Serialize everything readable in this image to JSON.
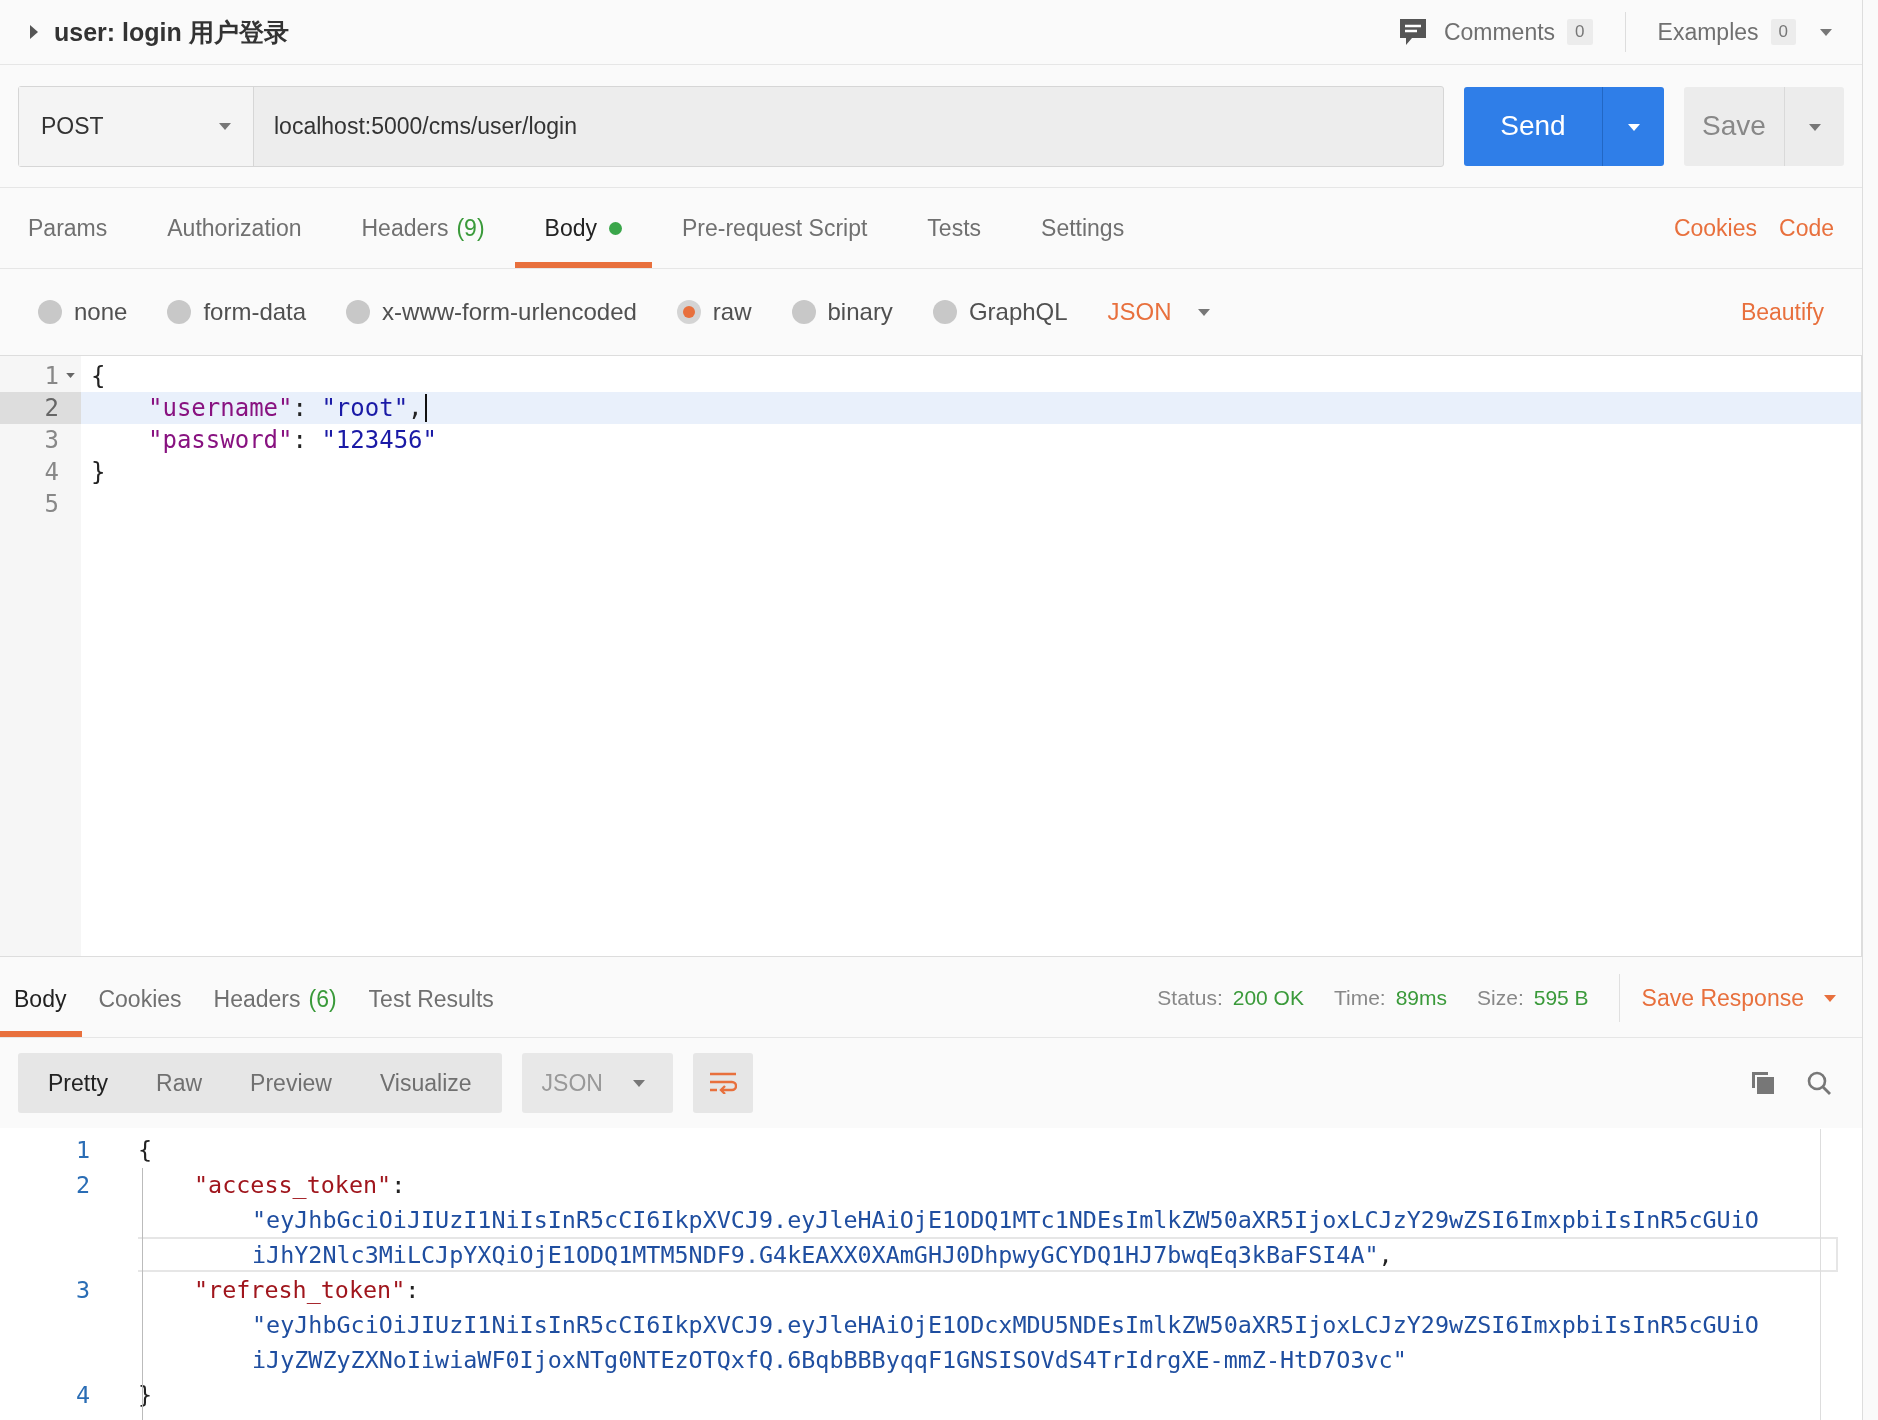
{
  "request": {
    "title": "user: login 用户登录",
    "comments": {
      "label": "Comments",
      "count": "0"
    },
    "examples": {
      "label": "Examples",
      "count": "0"
    },
    "method": "POST",
    "url": "localhost:5000/cms/user/login",
    "send": "Send",
    "save": "Save",
    "tabs": [
      {
        "label": "Params",
        "selected": false
      },
      {
        "label": "Authorization",
        "selected": false
      },
      {
        "label": "Headers",
        "count": "(9)",
        "selected": false
      },
      {
        "label": "Body",
        "dot": true,
        "selected": true
      },
      {
        "label": "Pre-request Script",
        "selected": false
      },
      {
        "label": "Tests",
        "selected": false
      },
      {
        "label": "Settings",
        "selected": false
      }
    ],
    "links": [
      "Cookies",
      "Code"
    ],
    "body_types": [
      {
        "label": "none",
        "selected": false
      },
      {
        "label": "form-data",
        "selected": false
      },
      {
        "label": "x-www-form-urlencoded",
        "selected": false
      },
      {
        "label": "raw",
        "selected": true
      },
      {
        "label": "binary",
        "selected": false
      },
      {
        "label": "GraphQL",
        "selected": false
      }
    ],
    "language": "JSON",
    "beautify": "Beautify",
    "editor": [
      {
        "number": "1",
        "foldable": true,
        "active": false,
        "kind": "brace",
        "parts": [
          {
            "kind": "punct",
            "text": "{"
          }
        ]
      },
      {
        "number": "2",
        "active": true,
        "cursor": true,
        "kind": "member",
        "parts": [
          {
            "kind": "key",
            "text": "\"username\""
          },
          {
            "kind": "punct",
            "text": ": "
          },
          {
            "kind": "string",
            "text": "\"root\""
          },
          {
            "kind": "punct",
            "text": ","
          }
        ]
      },
      {
        "number": "3",
        "active": false,
        "kind": "member",
        "parts": [
          {
            "kind": "key",
            "text": "\"password\""
          },
          {
            "kind": "punct",
            "text": ": "
          },
          {
            "kind": "string",
            "text": "\"123456\""
          }
        ]
      },
      {
        "number": "4",
        "active": false,
        "kind": "brace",
        "parts": [
          {
            "kind": "punct",
            "text": "}"
          }
        ]
      },
      {
        "number": "5",
        "active": false,
        "kind": "brace"
      }
    ]
  },
  "response": {
    "tabs": [
      {
        "label": "Body",
        "selected": true
      },
      {
        "label": "Cookies",
        "selected": false
      },
      {
        "label": "Headers",
        "count": "(6)",
        "selected": false
      },
      {
        "label": "Test Results",
        "selected": false
      }
    ],
    "stats": [
      {
        "label": "Status:",
        "value": "200 OK"
      },
      {
        "label": "Time:",
        "value": "89ms"
      },
      {
        "label": "Size:",
        "value": "595 B"
      }
    ],
    "save_response": "Save Response",
    "views": [
      {
        "label": "Pretty",
        "selected": true
      },
      {
        "label": "Raw",
        "selected": false
      },
      {
        "label": "Preview",
        "selected": false
      },
      {
        "label": "Visualize",
        "selected": false
      }
    ],
    "format": "JSON",
    "lines": [
      {
        "number": "1",
        "kind": "brace",
        "parts": [
          {
            "kind": "punct",
            "text": "{"
          }
        ]
      },
      {
        "number": "2",
        "kind": "member",
        "parts": [
          {
            "kind": "key",
            "text": "\"access_token\""
          },
          {
            "kind": "punct",
            "text": ":"
          }
        ]
      },
      {
        "kind": "wrap",
        "active": false,
        "parts": [
          {
            "kind": "string",
            "text": "\"eyJhbGciOiJIUzI1NiIsInR5cCI6IkpXVCJ9.eyJleHAiOjE1ODQ1MTc1NDEsImlkZW50aXR5IjoxLCJzY29wZSI6ImxpbiIsInR5cGUiO"
          }
        ]
      },
      {
        "kind": "wrap",
        "active": true,
        "parts": [
          {
            "kind": "string",
            "text": "iJhY2Nlc3MiLCJpYXQiOjE1ODQ1MTM5NDF9.G4kEAXX0XAmGHJ0DhpwyGCYDQ1HJ7bwqEq3kBaFSI4A\""
          },
          {
            "kind": "punct",
            "text": ","
          }
        ]
      },
      {
        "number": "3",
        "kind": "member",
        "parts": [
          {
            "kind": "key",
            "text": "\"refresh_token\""
          },
          {
            "kind": "punct",
            "text": ":"
          }
        ]
      },
      {
        "kind": "wrap",
        "active": false,
        "parts": [
          {
            "kind": "string",
            "text": "\"eyJhbGciOiJIUzI1NiIsInR5cCI6IkpXVCJ9.eyJleHAiOjE1ODcxMDU5NDEsImlkZW50aXR5IjoxLCJzY29wZSI6ImxpbiIsInR5cGUiO"
          }
        ]
      },
      {
        "kind": "wrap",
        "active": false,
        "parts": [
          {
            "kind": "string",
            "text": "iJyZWZyZXNoIiwiaWF0IjoxNTg0NTEzOTQxfQ.6BqbBBByqqF1GNSISOVdS4TrIdrgXE-mmZ-HtD7O3vc\""
          }
        ]
      },
      {
        "number": "4",
        "kind": "brace",
        "parts": [
          {
            "kind": "punct",
            "text": "}"
          }
        ]
      }
    ]
  }
}
